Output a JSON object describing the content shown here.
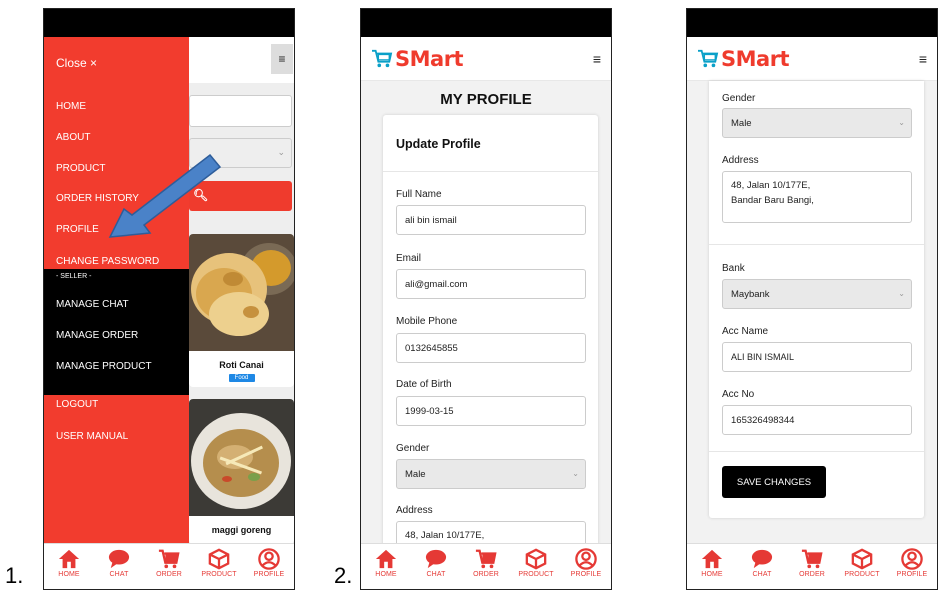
{
  "steps": {
    "one": "1.",
    "two": "2."
  },
  "app": {
    "logo_text": "SMart",
    "brand_color": "#ef3b2d",
    "cart_icon": "cart-icon"
  },
  "bottom_nav": {
    "home": "HOME",
    "chat": "CHAT",
    "order": "ORDER",
    "product": "PRODUCT",
    "profile": "PROFILE"
  },
  "drawer": {
    "close": "Close ×",
    "items": [
      "HOME",
      "ABOUT",
      "PRODUCT",
      "ORDER HISTORY",
      "PROFILE",
      "CHANGE PASSWORD"
    ],
    "seller_label": "- SELLER -",
    "seller_items": [
      "MANAGE CHAT",
      "MANAGE ORDER",
      "MANAGE PRODUCT"
    ],
    "after_items": [
      "LOGOUT",
      "USER MANUAL"
    ]
  },
  "products": [
    {
      "name": "Roti Canai",
      "badge": "Food"
    },
    {
      "name": "maggi goreng"
    }
  ],
  "profile": {
    "page_title": "MY PROFILE",
    "card_heading": "Update Profile",
    "full_name_label": "Full Name",
    "full_name": "ali bin ismail",
    "email_label": "Email",
    "email": "ali@gmail.com",
    "phone_label": "Mobile Phone",
    "phone": "0132645855",
    "dob_label": "Date of Birth",
    "dob": "1999-03-15",
    "gender_label": "Gender",
    "gender": "Male",
    "address_label": "Address",
    "address_line1": "48, Jalan 10/177E,",
    "address_line2": "Bandar Baru Bangi,",
    "bank_label": "Bank",
    "bank": "Maybank",
    "acc_name_label": "Acc Name",
    "acc_name": "ALI BIN ISMAIL",
    "acc_no_label": "Acc No",
    "acc_no": "165326498344",
    "save_button": "SAVE CHANGES"
  }
}
